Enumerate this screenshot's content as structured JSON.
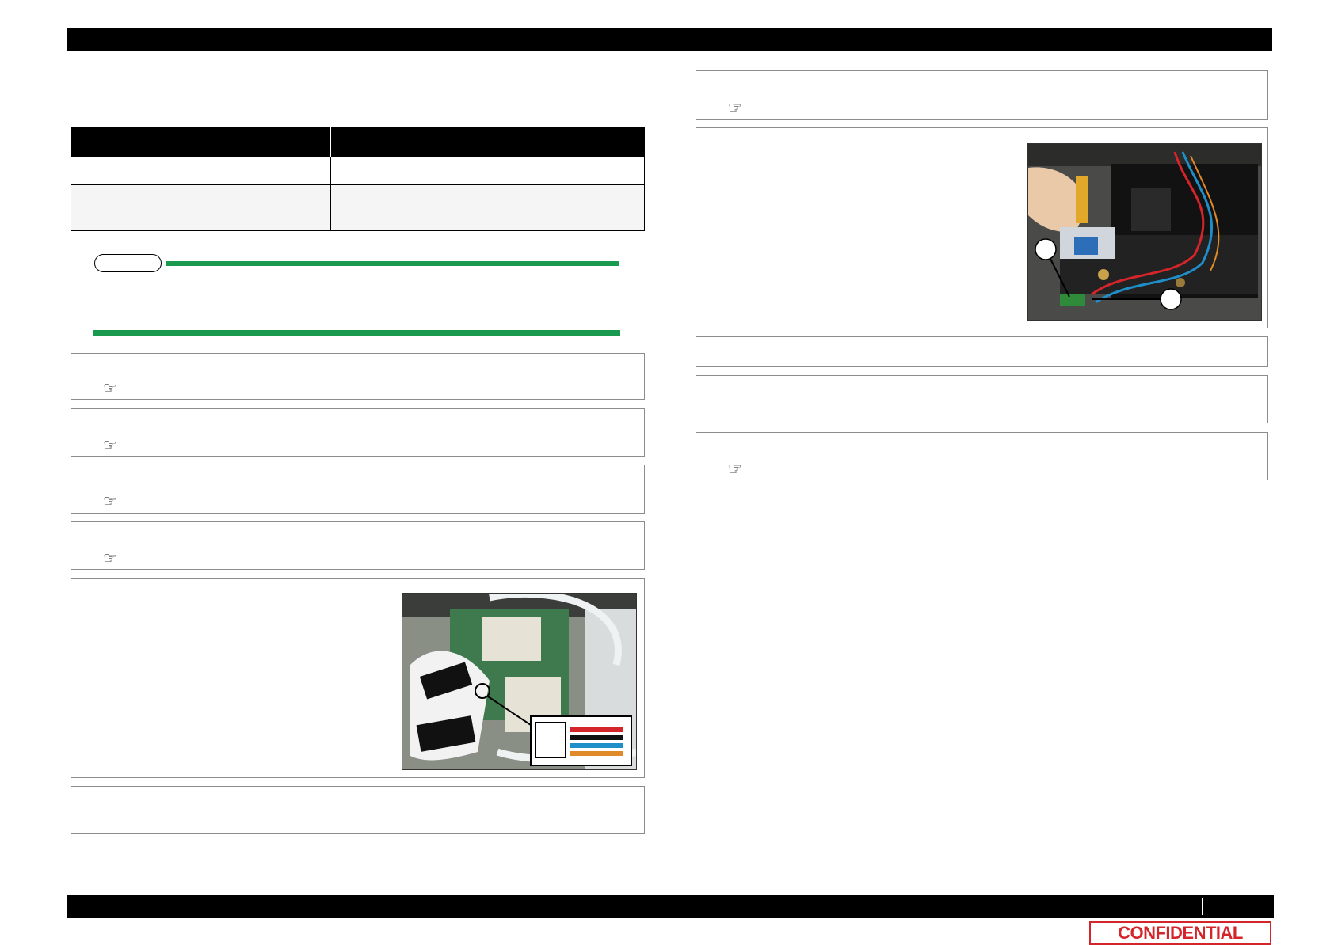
{
  "header": {
    "text": ""
  },
  "footer": {
    "page_label": ""
  },
  "spec_table": {
    "columns": [
      "",
      "",
      ""
    ],
    "rows": [
      [
        "",
        "",
        ""
      ],
      [
        "",
        "",
        ""
      ]
    ]
  },
  "note": {
    "label": ""
  },
  "icons": {
    "reference": "pointing-hand-icon",
    "callout_marker": "circle-marker-icon"
  },
  "colors": {
    "bar": "#000000",
    "note_line": "#1a9a4f",
    "confidential": "#d4252b",
    "cable_wires": [
      "#d4252b",
      "#111111",
      "#1f8fc9",
      "#e08a2a"
    ]
  },
  "confidential": {
    "label": "CONFIDENTIAL"
  }
}
